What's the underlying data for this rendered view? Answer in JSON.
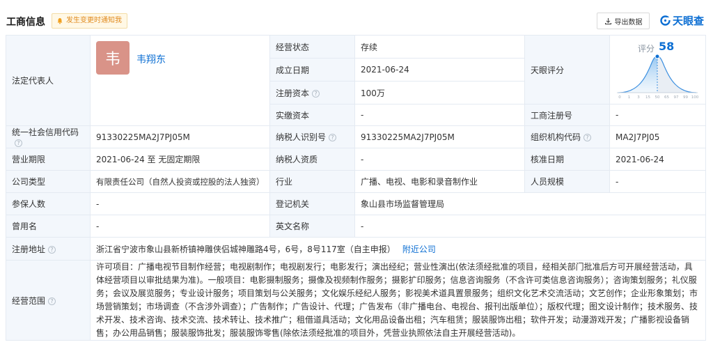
{
  "header": {
    "title": "工商信息",
    "notify_label": "发生变更时通知我",
    "export_label": "导出数据",
    "logo_text": "天眼查"
  },
  "rows": {
    "legal_rep_label": "法定代表人",
    "legal_rep_initial": "韦",
    "legal_rep_name": "韦翔东",
    "status_label": "经营状态",
    "status_value": "存续",
    "established_label": "成立日期",
    "established_value": "2021-06-24",
    "reg_capital_label": "注册资本",
    "reg_capital_value": "100万",
    "paid_capital_label": "实缴资本",
    "paid_capital_value": "-",
    "tianyan_score_label": "天眼评分",
    "score_title": "评分",
    "score_value": "58",
    "score_ticks": [
      "0",
      "1",
      "3",
      "15",
      "50",
      "65",
      "97",
      "99",
      "100"
    ],
    "biz_reg_no_label": "工商注册号",
    "biz_reg_no_value": "-",
    "credit_code_label": "统一社会信用代码",
    "credit_code_value": "91330225MA2J7PJ05M",
    "taxpayer_id_label": "纳税人识别号",
    "taxpayer_id_value": "91330225MA2J7PJ05M",
    "org_code_label": "组织机构代码",
    "org_code_value": "MA2J7PJ05",
    "term_label": "营业期限",
    "term_value": "2021-06-24  至 无固定期限",
    "taxpayer_qual_label": "纳税人资质",
    "taxpayer_qual_value": "-",
    "approval_date_label": "核准日期",
    "approval_date_value": "2021-06-24",
    "company_type_label": "公司类型",
    "company_type_value": "有限责任公司（自然人投资或控股的法人独资）",
    "industry_label": "行业",
    "industry_value": "广播、电视、电影和录音制作业",
    "staff_size_label": "人员规模",
    "staff_size_value": "-",
    "insured_label": "参保人数",
    "insured_value": "-",
    "reg_authority_label": "登记机关",
    "reg_authority_value": "象山县市场监督管理局",
    "former_name_label": "曾用名",
    "former_name_value": "-",
    "english_name_label": "英文名称",
    "english_name_value": "-",
    "address_label": "注册地址",
    "address_value": "浙江省宁波市象山县新桥镇神雕侠侣城神雕路4号，6号，8号117室（自主申报）",
    "nearby_label": "附近公司",
    "scope_label": "经营范围",
    "scope_value": "许可项目：广播电视节目制作经营；电视剧制作；电视剧发行；电影发行；演出经纪；营业性演出(依法须经批准的项目，经相关部门批准后方可开展经营活动，具体经营项目以审批结果为准)。一般项目：电影摄制服务；摄像及视频制作服务；摄影扩印服务；信息咨询服务（不含许可类信息咨询服务）；咨询策划服务；礼仪服务；会议及展览服务；专业设计服务；项目策划与公关服务；文化娱乐经纪人服务；影视美术道具置景服务；组织文化艺术交流活动；文艺创作；企业形象策划；市场营销策划；市场调查（不含涉外调查）；广告制作；广告设计、代理；广告发布（非广播电台、电视台、报刊出版单位）；版权代理；图文设计制作；技术服务、技术开发、技术咨询、技术交流、技术转让、技术推广；租借道具活动；文化用品设备出租；汽车租赁；服装服饰出租；软件开发；动漫游戏开发；广播影视设备销售；办公用品销售；服装服饰批发；服装服饰零售(除依法须经批准的项目外，凭营业执照依法自主开展经营活动)。"
  },
  "colors": {
    "brand": "#0d6fd3",
    "label_bg": "#f3f7fc",
    "border": "#e4eaf2",
    "notify_text": "#e08a1e",
    "avatar_bg": "#d99388"
  }
}
